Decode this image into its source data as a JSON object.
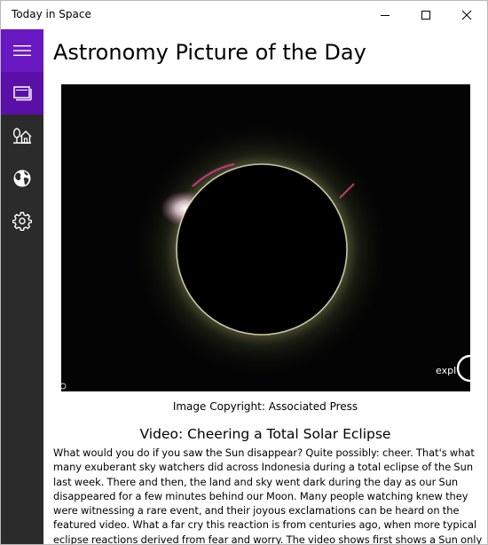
{
  "window": {
    "title": "Today in Space"
  },
  "nav": {
    "items": [
      {
        "icon": "hamburger-icon"
      },
      {
        "icon": "pictures-icon"
      },
      {
        "icon": "home-tree-icon"
      },
      {
        "icon": "globe-icon"
      },
      {
        "icon": "gear-icon"
      }
    ]
  },
  "main": {
    "page_title": "Astronomy Picture of the Day",
    "image_watermark": "expl",
    "copyright": "Image Copyright: Associated Press",
    "video_title": "Video: Cheering a Total Solar Eclipse",
    "description": "What would you do if you saw the Sun disappear?  Quite possibly: cheer.  That's what many exuberant sky watchers did across Indonesia during a total eclipse of the Sun last week. There and then, the land and sky went dark during the day as our Sun disappeared for a few minutes behind our Moon.  Many people watching knew they were witnessing a rare event, and their joyous exclamations can be heard on the featured video. What a far cry this reaction is from centuries ago, when more typical eclipse reactions derived from fear and worry.  The video shows first shows a Sun only partly eclipsed by the Moon as"
  },
  "colors": {
    "accent": "#6a18c2",
    "accent_selected": "#5a10a6",
    "sidebar": "#2b2b2b"
  }
}
